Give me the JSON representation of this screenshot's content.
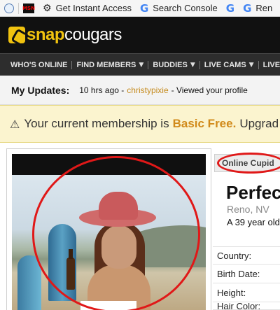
{
  "bookmarks": [
    {
      "label": "",
      "icon": "globe-icon"
    },
    {
      "label": "",
      "icon": "msn-icon",
      "icon_text": "MSN"
    },
    {
      "label": "Get Instant Access",
      "icon": "gear-icon"
    },
    {
      "label": "Search Console",
      "icon": "google-icon"
    },
    {
      "label": "",
      "icon": "google-icon"
    },
    {
      "label": "Ren",
      "icon": "google-icon"
    }
  ],
  "header": {
    "logo_snap": "snap",
    "logo_cougars": "cougars",
    "brand_color": "#f0c20f"
  },
  "nav": {
    "items": [
      {
        "label": "WHO'S ONLINE",
        "has_caret": false
      },
      {
        "label": "FIND MEMBERS",
        "has_caret": true
      },
      {
        "label": "BUDDIES",
        "has_caret": true
      },
      {
        "label": "LIVE CAMS",
        "has_caret": true
      },
      {
        "label": "LIVE CHAT",
        "has_caret": false
      }
    ],
    "caret": "▼"
  },
  "updates": {
    "label": "My Updates:",
    "time": "10 hrs ago -",
    "user": "christypixie",
    "action": "- Viewed your profile"
  },
  "notice": {
    "prefix": "Your current membership is",
    "plan": "Basic Free.",
    "suffix": "Upgrad",
    "icon": "warning-icon",
    "warn_glyph": "⚠"
  },
  "profile": {
    "cupid_label": "Online Cupid",
    "name": "Perfect",
    "location": "Reno, NV",
    "age_line": "A 39 year old",
    "details": [
      "Country:",
      "Birth Date:",
      "Height:",
      "Hair Color:"
    ]
  },
  "colors": {
    "highlight_circle": "#e01818",
    "accent_orange": "#d18a1a",
    "link": "#c58b1e"
  }
}
